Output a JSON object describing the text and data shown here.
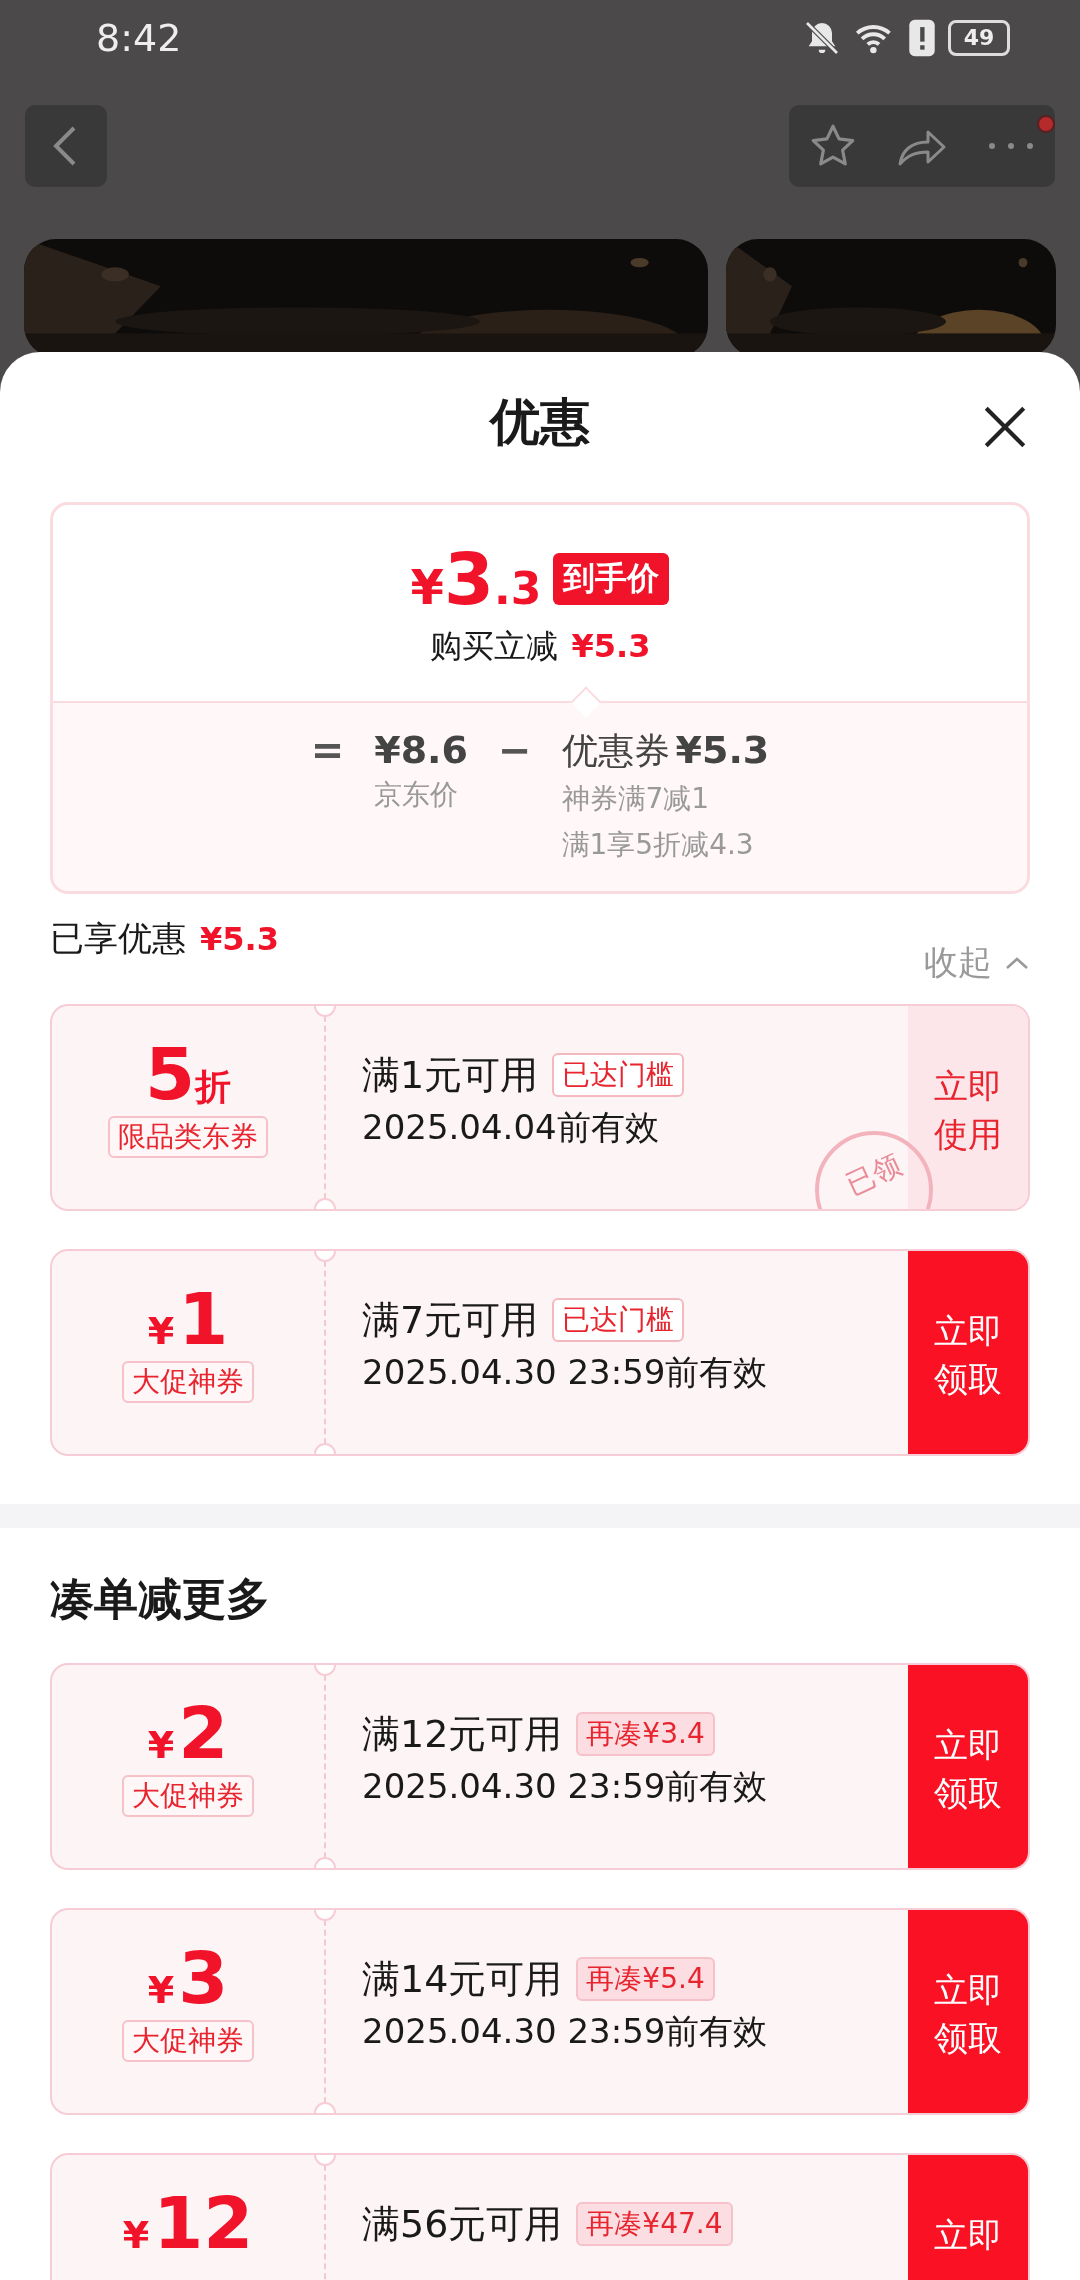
{
  "status_bar": {
    "time": "8:42",
    "battery": "49"
  },
  "header": {
    "more_badge": true
  },
  "sheet": {
    "title": "优惠"
  },
  "summary": {
    "currency": "¥",
    "price_integer": "3",
    "price_decimal": ".3",
    "price_tag": "到手价",
    "instant_label": "购买立减",
    "instant_amount": "¥5.3",
    "equals": "=",
    "base_price": "¥8.6",
    "base_label": "京东价",
    "minus": "−",
    "coupon_label": "优惠券",
    "coupon_amount": "¥5.3",
    "details": [
      "神券满7减1",
      "满1享5折减4.3"
    ]
  },
  "enjoyed": {
    "label": "已享优惠",
    "amount": "¥5.3",
    "toggle": "收起",
    "expanded": true
  },
  "coupons": [
    {
      "value": "5",
      "suffix": "折",
      "tag": "限品类东券",
      "condition": "满1元可用",
      "badge": {
        "kind": "reached",
        "text": "已达门槛"
      },
      "validity": "2025.04.04前有效",
      "action": "立即使用",
      "claimed": true,
      "stamp": "已领"
    },
    {
      "prefix": "¥",
      "value": "1",
      "tag": "大促神券",
      "condition": "满7元可用",
      "badge": {
        "kind": "reached",
        "text": "已达门槛"
      },
      "validity": "2025.04.30 23:59前有效",
      "action": "立即领取",
      "claimed": false
    }
  ],
  "more_section": {
    "title": "凑单减更多",
    "coupons": [
      {
        "prefix": "¥",
        "value": "2",
        "tag": "大促神券",
        "condition": "满12元可用",
        "badge": {
          "kind": "short",
          "text": "再凑¥3.4"
        },
        "validity": "2025.04.30 23:59前有效",
        "action": "立即领取",
        "claimed": false
      },
      {
        "prefix": "¥",
        "value": "3",
        "tag": "大促神券",
        "condition": "满14元可用",
        "badge": {
          "kind": "short",
          "text": "再凑¥5.4"
        },
        "validity": "2025.04.30 23:59前有效",
        "action": "立即领取",
        "claimed": false
      },
      {
        "prefix": "¥",
        "value": "12",
        "condition": "满56元可用",
        "badge": {
          "kind": "short",
          "text": "再凑¥47.4"
        },
        "action": "立即",
        "claimed": false
      }
    ]
  }
}
